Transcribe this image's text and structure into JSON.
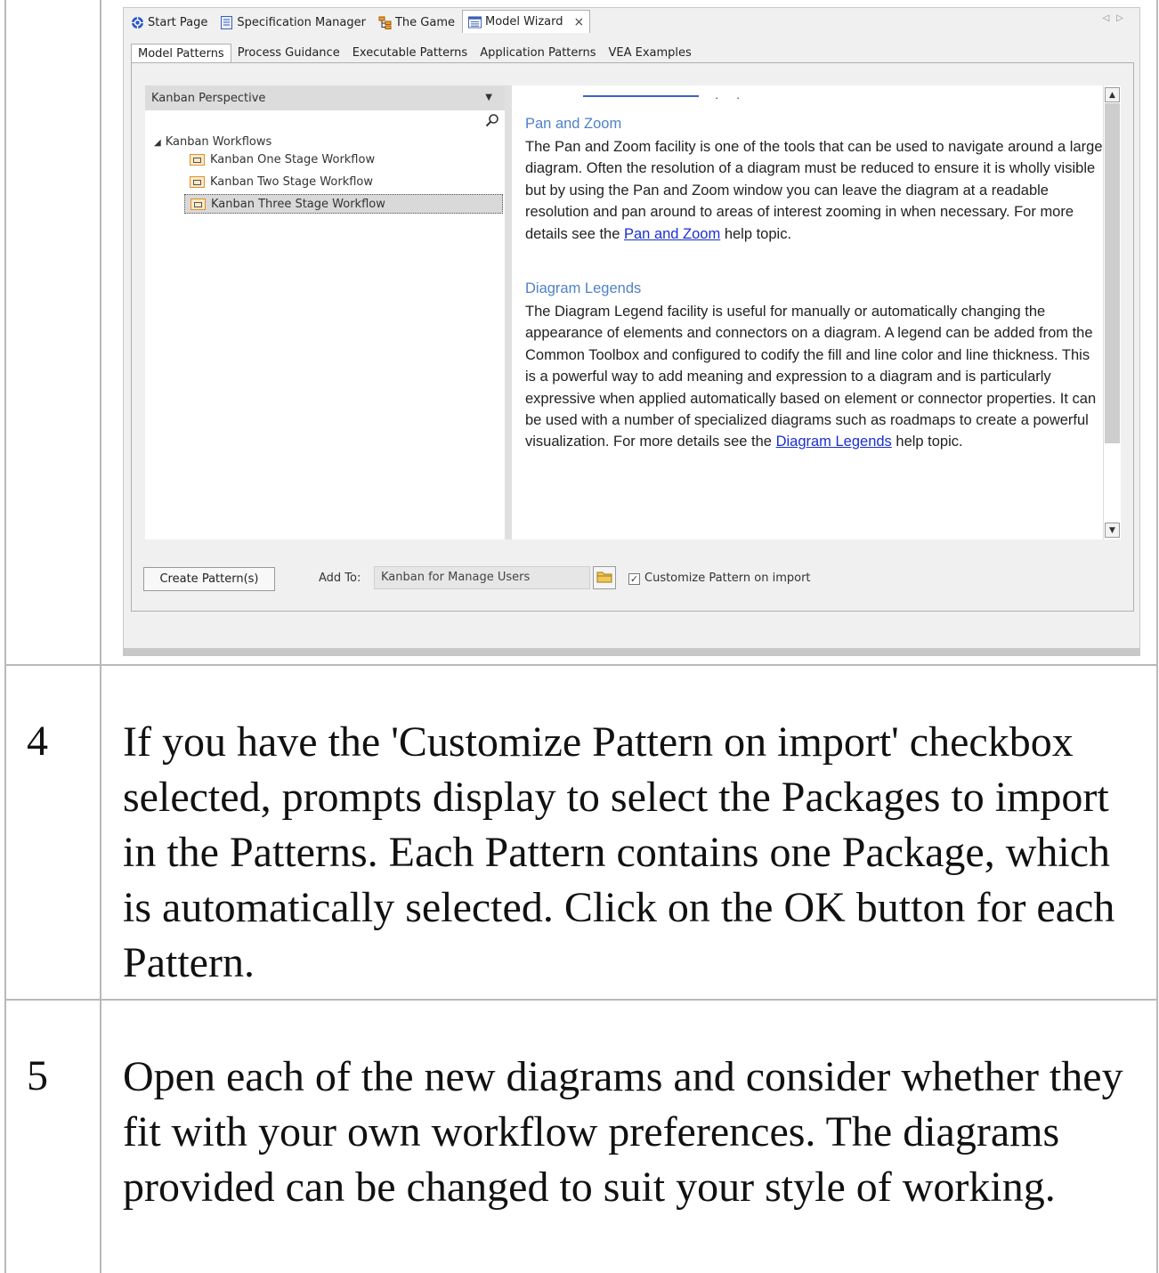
{
  "window": {
    "doc_tabs": [
      {
        "label": "Start Page",
        "icon": "start-page-icon"
      },
      {
        "label": "Specification Manager",
        "icon": "specification-icon"
      },
      {
        "label": "The Game",
        "icon": "hierarchy-icon"
      },
      {
        "label": "Model Wizard",
        "icon": "model-wizard-icon",
        "close": "×"
      }
    ],
    "inner_tabs": [
      "Model Patterns",
      "Process Guidance",
      "Executable Patterns",
      "Application Patterns",
      "VEA Examples"
    ],
    "perspective": "Kanban Perspective",
    "tree": {
      "root": "Kanban Workflows",
      "items": [
        "Kanban One Stage Workflow",
        "Kanban Two Stage Workflow",
        "Kanban Three Stage Workflow"
      ]
    },
    "help": {
      "pan_title": "Pan and Zoom",
      "pan_body_1": "The Pan and Zoom facility is one of the tools that can be used to navigate around a large diagram. Often the resolution of a diagram must be reduced to ensure it is wholly visible but by using the Pan and Zoom window you can leave the diagram at a readable resolution and pan around to areas of interest zooming in when necessary. For more details see the ",
      "pan_link": "Pan and Zoom",
      "pan_body_2": " help topic.",
      "legend_title": "Diagram Legends",
      "legend_body_1": "The Diagram Legend facility is useful for manually or automatically changing the appearance of elements and connectors on a diagram. A legend can be added from the Common Toolbox and configured to codify the fill and line color and line thickness. This is a powerful way to add meaning and expression to a diagram and is particularly expressive when applied automatically based on element or connector properties. It can be used with a number of specialized diagrams such as roadmaps to create a powerful visualization.  For more details see the ",
      "legend_link": "Diagram Legends",
      "legend_body_2": " help topic."
    },
    "create_button": "Create Pattern(s)",
    "add_to_label": "Add To:",
    "add_to_value": "Kanban for Manage Users",
    "customize_checked": true,
    "customize_label": "Customize Pattern on import"
  },
  "steps": [
    {
      "number": "4",
      "text": "If you have the 'Customize Pattern on import' checkbox selected, prompts display to select the Packages to import in the Patterns. Each Pattern contains one Package, which is automatically selected. Click on the OK button for each Pattern."
    },
    {
      "number": "5",
      "text": "Open each of the new diagrams and consider whether they fit with your own workflow preferences. The diagrams provided can be changed to suit your style of working."
    }
  ]
}
